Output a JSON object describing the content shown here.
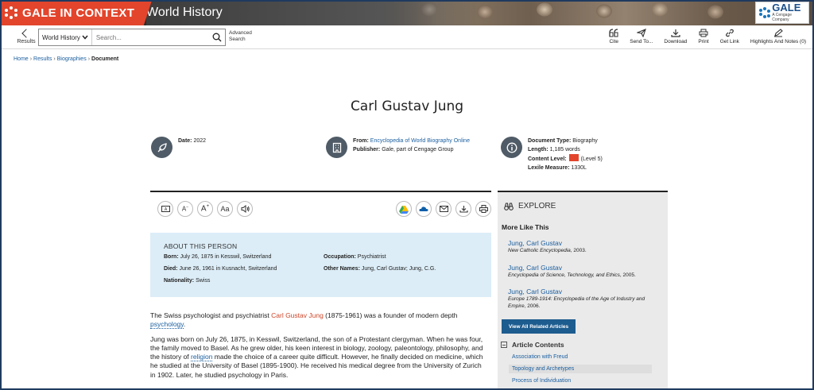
{
  "banner": {
    "brand": "GALE IN CONTEXT",
    "product": "World History",
    "logo_word": "GALE",
    "logo_sub": "A Cengage Company"
  },
  "toolbar": {
    "back_label": "Results",
    "scope": "World History",
    "search_placeholder": "Search...",
    "advanced_line1": "Advanced",
    "advanced_line2": "Search",
    "tools": {
      "cite": "Cite",
      "send": "Send To...",
      "download": "Download",
      "print": "Print",
      "link": "Get Link",
      "highlights": "Highlights And Notes (0)"
    }
  },
  "breadcrumb": {
    "home": "Home",
    "results": "Results",
    "bios": "Biographies",
    "current": "Document"
  },
  "doc": {
    "title": "Carl Gustav Jung",
    "date_label": "Date:",
    "date": "2022",
    "from_label": "From:",
    "from": "Encyclopedia of World Biography Online",
    "publisher_label": "Publisher:",
    "publisher": "Gale, part of Cengage Group",
    "type_label": "Document Type:",
    "type": "Biography",
    "length_label": "Length:",
    "length": "1,185 words",
    "level_label": "Content Level:",
    "level": "(Level 5)",
    "lexile_label": "Lexile Measure:",
    "lexile": "1330L"
  },
  "about": {
    "heading": "ABOUT THIS PERSON",
    "born_label": "Born:",
    "born": "July 26, 1875 in Kesswil, Switzerland",
    "died_label": "Died:",
    "died": "June 26, 1961 in Kusnacht, Switzerland",
    "nat_label": "Nationality:",
    "nat": "Swiss",
    "occ_label": "Occupation:",
    "occ": "Psychiatrist",
    "other_label": "Other Names:",
    "other": "Jung, Carl Gustav; Jung, C.G."
  },
  "body": {
    "p1_a": "The Swiss psychologist and psychiatrist ",
    "p1_link": "Carl Gustav Jung",
    "p1_b": " (1875-1961) was a founder of modern depth ",
    "p1_link2": "psychology",
    "p1_c": ".",
    "p2_a": "Jung was born on July 26, 1875, in Kesswil, Switzerland, the son of a Protestant clergyman. When he was four, the family moved to Basel. As he grew older, his keen interest in biology, zoology, paleontology, philosophy, and the history of ",
    "p2_link": "religion",
    "p2_b": " made the choice of a career quite difficult. However, he finally decided on medicine, which he studied at the University of Basel (1895-1900). He received his medical degree from the University of Zurich in 1902. Later, he studied psychology in Paris."
  },
  "explore": {
    "heading": "EXPLORE",
    "more_like": "More Like This",
    "related": [
      {
        "title": "Jung, Carl Gustav",
        "source": "New Catholic Encyclopedia",
        "year": ", 2003."
      },
      {
        "title": "Jung, Carl Gustav",
        "source": "Encyclopedia of Science, Technology, and Ethics",
        "year": ", 2005."
      },
      {
        "title": "Jung, Carl Gustav",
        "source": "Europe 1789-1914: Encyclopedia of the Age of Industry and Empire",
        "year": ", 2006."
      }
    ],
    "view_all": "View All Related Articles",
    "contents_heading": "Article Contents",
    "contents": [
      "Association with Freud",
      "Topology and Archetypes",
      "Process of Individuation"
    ]
  },
  "colors": {
    "brand": "#e2452c",
    "link": "#1b5fa0",
    "button": "#1d5c8f",
    "about_bg": "#dcedf7"
  }
}
